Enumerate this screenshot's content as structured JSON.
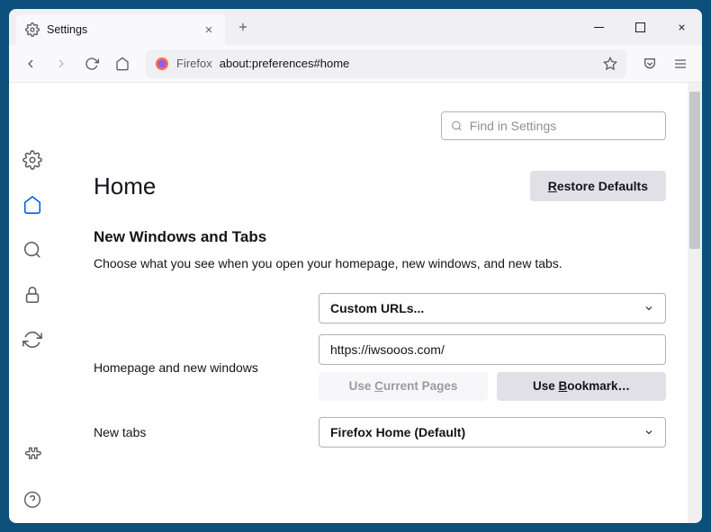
{
  "tab": {
    "title": "Settings"
  },
  "urlbar": {
    "protocol": "Firefox",
    "path": "about:preferences#home"
  },
  "search": {
    "placeholder": "Find in Settings"
  },
  "page": {
    "title": "Home",
    "restore": "Restore Defaults",
    "section_title": "New Windows and Tabs",
    "section_desc": "Choose what you see when you open your homepage, new windows, and new tabs.",
    "homepage_mode": "Custom URLs...",
    "homepage_label": "Homepage and new windows",
    "homepage_value": "https://iwsooos.com/",
    "use_current_pre": "Use ",
    "use_current_u": "C",
    "use_current_post": "urrent Pages",
    "use_bookmark_pre": "Use ",
    "use_bookmark_u": "B",
    "use_bookmark_post": "ookmark…",
    "newtabs_label": "New tabs",
    "newtabs_value": "Firefox Home (Default)"
  },
  "restore_u": "R",
  "restore_post": "estore Defaults"
}
